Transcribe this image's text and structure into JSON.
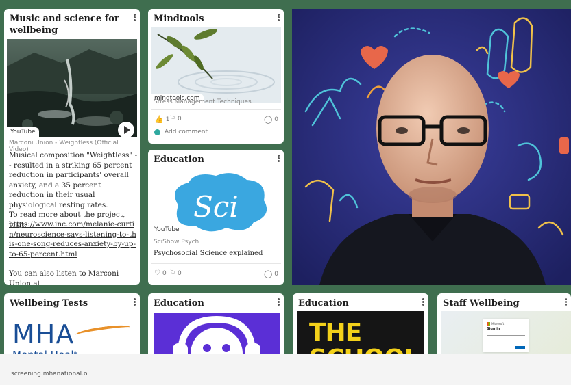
{
  "cards": {
    "music": {
      "title": "Music and science for wellbeing",
      "badge": "YouTube",
      "video_title": "Marconi Union - Weightless (Official Video)",
      "para1": "Musical composition \"Weightless\" -- resulted in a striking 65 percent reduction in participants' overall anxiety, and a 35 percent reduction in their usual physiological resting rates.",
      "para2": "To read more about the project, visit:",
      "link": "https://www.inc.com/melanie-curtin/neuroscience-says-listening-to-this-one-song-reduces-anxiety-by-up-to-65-percent.html",
      "para3": "You can also listen to Marconi Union at"
    },
    "mindtools": {
      "title": "Mindtools",
      "badge": "mindtools.com",
      "caption": "Stress Management Techniques",
      "likes": "1",
      "dislikes": "0",
      "comments": "0",
      "add_comment": "Add comment"
    },
    "education1": {
      "title": "Education",
      "logo_text": "Sci",
      "badge": "YouTube",
      "source": "SciShow Psych",
      "caption": "Psychosocial Science explained",
      "likes": "0",
      "dislikes": "0",
      "comments": "0"
    },
    "wellbeing_tests": {
      "title": "Wellbeing Tests",
      "logo_text": "MHA",
      "logo_sub": "Mental Healt",
      "url": "screening.mhanational.o"
    },
    "education2": {
      "title": "Education"
    },
    "education3": {
      "title": "Education",
      "image_text_1": "THE",
      "image_text_2": "SCHOOL"
    },
    "staff_wellbeing": {
      "title": "Staff Wellbeing",
      "ms_brand": "Microsoft",
      "signin": "Sign in"
    }
  },
  "colors": {
    "background": "#3f6e4f",
    "sci_blue": "#3aa7e0",
    "purple": "#5b2fd6",
    "yellow": "#f3d11a",
    "mha_blue": "#1a4e96",
    "hero_bg": "#242770"
  }
}
